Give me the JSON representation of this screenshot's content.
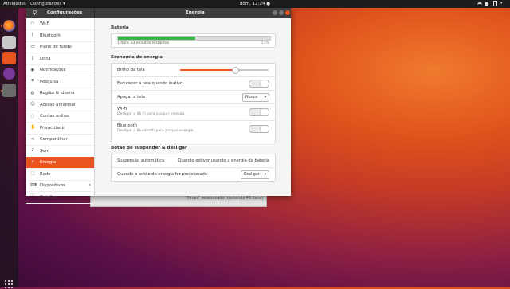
{
  "topbar": {
    "activities": "Atividades",
    "app_menu": "Configurações ▾",
    "clock": "dom, 12:24 ●"
  },
  "dock": {
    "items": [
      "firefox-icon",
      "files-icon",
      "software-icon",
      "help-icon",
      "settings-icon"
    ],
    "show_apps": "grid-icon"
  },
  "background_window": {
    "status_text": "\"filmes\" selecionado (contendo 45 itens)"
  },
  "header": {
    "left_title": "Configurações",
    "main_title": "Energia"
  },
  "sidebar": {
    "items": [
      {
        "label": "Wi-Fi",
        "icon": "wifi-icon",
        "glyph": "◠"
      },
      {
        "label": "Bluetooth",
        "icon": "bluetooth-icon",
        "glyph": "ᛒ"
      },
      {
        "label": "Plano de fundo",
        "icon": "background-icon",
        "glyph": "▭"
      },
      {
        "label": "Doca",
        "icon": "dock-icon",
        "glyph": "▯"
      },
      {
        "label": "Notificações",
        "icon": "notifications-icon",
        "glyph": "◉"
      },
      {
        "label": "Pesquisa",
        "icon": "search-icon",
        "glyph": "⚲"
      },
      {
        "label": "Região & idioma",
        "icon": "region-icon",
        "glyph": "◍"
      },
      {
        "label": "Acesso universal",
        "icon": "accessibility-icon",
        "glyph": "☺"
      },
      {
        "label": "Contas online",
        "icon": "accounts-icon",
        "glyph": "◌"
      },
      {
        "label": "Privacidade",
        "icon": "privacy-icon",
        "glyph": "✋"
      },
      {
        "label": "Compartilhar",
        "icon": "share-icon",
        "glyph": "⋖"
      },
      {
        "label": "Som",
        "icon": "sound-icon",
        "glyph": "♪"
      },
      {
        "label": "Energia",
        "icon": "power-icon",
        "glyph": "⚡"
      },
      {
        "label": "Rede",
        "icon": "network-icon",
        "glyph": "⬚"
      },
      {
        "label": "Dispositivos",
        "icon": "devices-icon",
        "glyph": "⌨",
        "arrow": "›"
      },
      {
        "label": "Detalhes",
        "icon": "details-icon",
        "glyph": "ⓘ",
        "arrow": "›"
      }
    ],
    "selected_index": 12
  },
  "battery": {
    "section_title": "Bateria",
    "remaining_text": "1 hora 33 minutos restantes",
    "percent_text": "51%",
    "level": 0.51
  },
  "energy_saving": {
    "section_title": "Economia de energia",
    "brightness_label": "Brilho da tela",
    "brightness_level": 0.62,
    "dim_label": "Escurecer a tela quando inativo",
    "dim_on": false,
    "blank_label": "Apagar a tela",
    "blank_value": "Nunca",
    "wifi_label": "Wi-Fi",
    "wifi_sub": "Desligar o Wi-Fi para poupar energia.",
    "wifi_on": false,
    "bt_label": "Bluetooth",
    "bt_sub": "Desligar o Bluetooth para poupar energia.",
    "bt_on": false
  },
  "suspend": {
    "section_title": "Botão de suspender & desligar",
    "auto_label": "Suspensão automática",
    "auto_value": "Quando estiver usando a energia da bateria",
    "button_label": "Quando o botão de energia for pressionado",
    "button_value": "Desligar"
  }
}
